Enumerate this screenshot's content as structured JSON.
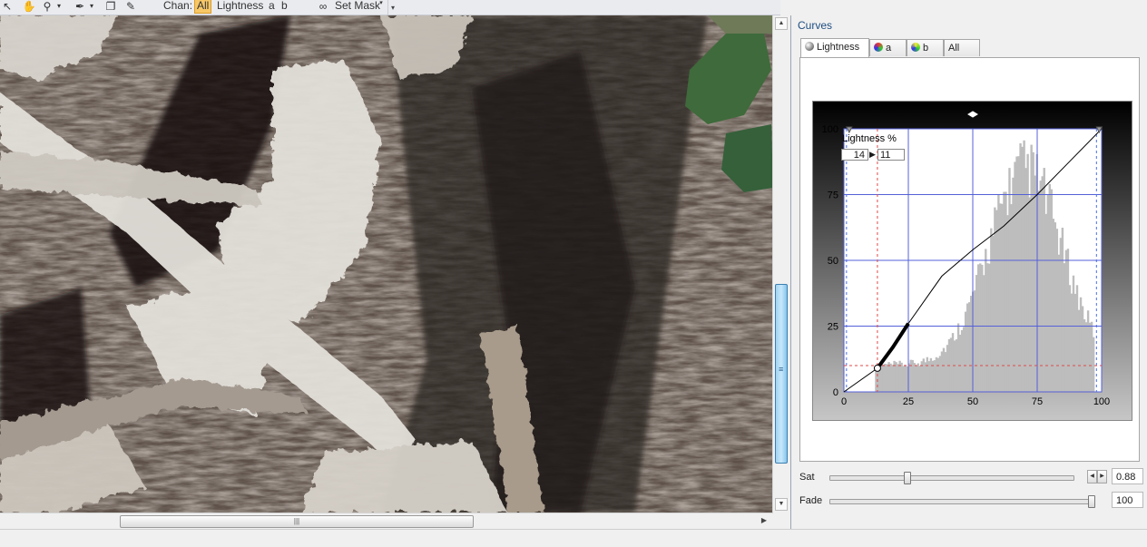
{
  "toolbar": {
    "tools": [
      "arrow-pointer-icon",
      "hand-pan-icon",
      "zoom-magnifier-icon",
      "eyedropper-icon",
      "copy-pages-icon",
      "brush-icon"
    ],
    "chan_label": "Chan:",
    "channels": [
      "All",
      "Lightness",
      "a",
      "b"
    ],
    "selected_channel": "All",
    "set_mask_label": "Set Mask",
    "accent": "#f7c766"
  },
  "panel": {
    "title": "Curves",
    "tabs": [
      {
        "label": "Lightness",
        "icon": "gray-sphere-icon",
        "active": true
      },
      {
        "label": "a",
        "icon": "color-sphere-icon",
        "active": false
      },
      {
        "label": "b",
        "icon": "color-sphere-icon",
        "active": false
      },
      {
        "label": "All",
        "icon": "",
        "active": false
      }
    ],
    "curve": {
      "label": "Lightness %",
      "point_in": "14",
      "point_out": "11",
      "y_ticks": [
        "0",
        "25",
        "50",
        "75",
        "100"
      ],
      "x_ticks": [
        "0",
        "25",
        "50",
        "75",
        "100"
      ],
      "curve_points": [
        [
          0,
          0
        ],
        [
          13,
          9
        ],
        [
          19,
          17
        ],
        [
          25,
          26
        ],
        [
          38,
          44
        ],
        [
          50,
          54
        ],
        [
          62,
          63
        ],
        [
          75,
          75
        ],
        [
          88,
          88
        ],
        [
          100,
          100
        ]
      ],
      "control_point": [
        13,
        9
      ],
      "range_guides": [
        1,
        98
      ],
      "selection_guide": {
        "x": 13,
        "y": 10
      },
      "histogram_color": "#bdbdbd",
      "curve_color": "#000000",
      "grid_color": "#5560d8"
    },
    "sat": {
      "label": "Sat",
      "value": "0.88",
      "fraction": 0.31
    },
    "fade": {
      "label": "Fade",
      "value": "100",
      "fraction": 1.0
    }
  }
}
